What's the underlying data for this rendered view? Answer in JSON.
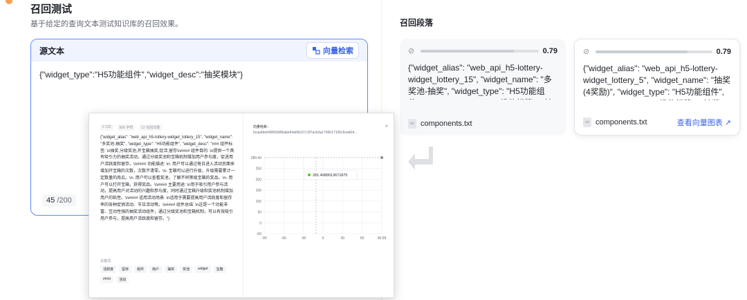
{
  "page": {
    "title": "召回测试",
    "subtitle": "基于给定的查询文本测试知识库的召回效果。"
  },
  "source": {
    "title": "源文本",
    "search_button": "向量检索",
    "text": "{\"widget_type\":\"H5功能组件\",\"widget_desc\":\"抽奖模块\"}",
    "count_current": "45",
    "count_max": "/200"
  },
  "recall": {
    "title": "召回段落",
    "results": [
      {
        "score": "0.79",
        "score_fraction": 0.79,
        "text": "{\"widget_alias\": \"web_api_h5-lottery-widget_lottery_15\", \"widget_name\": \"多奖池-抽奖\", \"widget_type\": \"H5功能组件\", \"widget_desc\": \"### 组件标签: \\n抽",
        "file": "components.txt"
      },
      {
        "score": "0.79",
        "score_fraction": 0.79,
        "text": "{\"widget_alias\": \"web_api_h5-lottery-widget_lottery_5\", \"widget_name\": \"抽奖(4奖励)\", \"widget_type\": \"H5功能组件\", \"widget_desc\": \"### 组件标签: \\n抽奖,",
        "file": "components.txt",
        "link": "查看向量图表 ↗"
      }
    ]
  },
  "overlay": {
    "tags": [
      "# 122",
      "506 字符",
      "12 召回次数"
    ],
    "content": "{\"widget_alias\": \"web_api_h5-lottery-widget_lottery_15\", \"widget_name\": \"多奖池-抽奖\", \"widget_type\": \"H5功能组件\", \"widget_desc\": \"### 组件标签: \\n抽奖,分级奖池,开宝箱抽奖,促活,留存\\n#### 组件目的: \\n提供一个具有吸引力的抽奖活动，通过分级奖池和宝箱机制增加用户参与度，促进用户活跃度和留存。\\n#### 功能描述: \\n- 用户可以通过每日进入活动页面来增加开宝箱的次数，次数不清零。\\n- 宝箱可以进行升级，升级需要累计一定数量的南瓜。\\n- 用户可以查看奖池，了解不同等级宝箱的奖品。\\n- 用户可以打开宝箱，获得奖品。\\n#### 主要用途: \\n用于吸引用户参与活动，提高用户对活动的兴趣和参与度，同时通过宝箱升级和奖池机制增加用户的粘性。\\n#### 适用活动场景: \\n适用于需要提高用户活跃度和留存率的各种促销活动、节日活动等。\\n#### 组件总结: \\n这是一个功能丰富、互动性强的抽奖活动组件，通过分级奖池和宝箱机制，可以有效吸引用户参与，提高用户活跃度和留存。\"}",
    "keywords_label": "关键词",
    "keywords": [
      "活跃度",
      "留存",
      "组件",
      "用户",
      "抽奖",
      "奖池",
      "widget",
      "宝箱",
      "####",
      "活动"
    ],
    "vector_label": "向量哈希：",
    "vector_id": "6caa4be649600d06abe94a6fb317c3f7acb3a1746017100c5ceb04...",
    "close": "×",
    "chart_data": {
      "type": "scatter",
      "x": [
        281.4989013671875
      ],
      "y": [
        280.4
      ],
      "ylim": [
        -50,
        280.4
      ],
      "xlim": [
        -90,
        90.58
      ],
      "yticks": [
        "280.40",
        "250",
        "200",
        "150",
        "100",
        "50",
        "0",
        "-50"
      ],
      "xticks": [
        "-90",
        "-60",
        "-30",
        "0",
        "30",
        "60",
        "90.58"
      ],
      "tooltip": "281.4989013671875",
      "grid": true
    }
  }
}
